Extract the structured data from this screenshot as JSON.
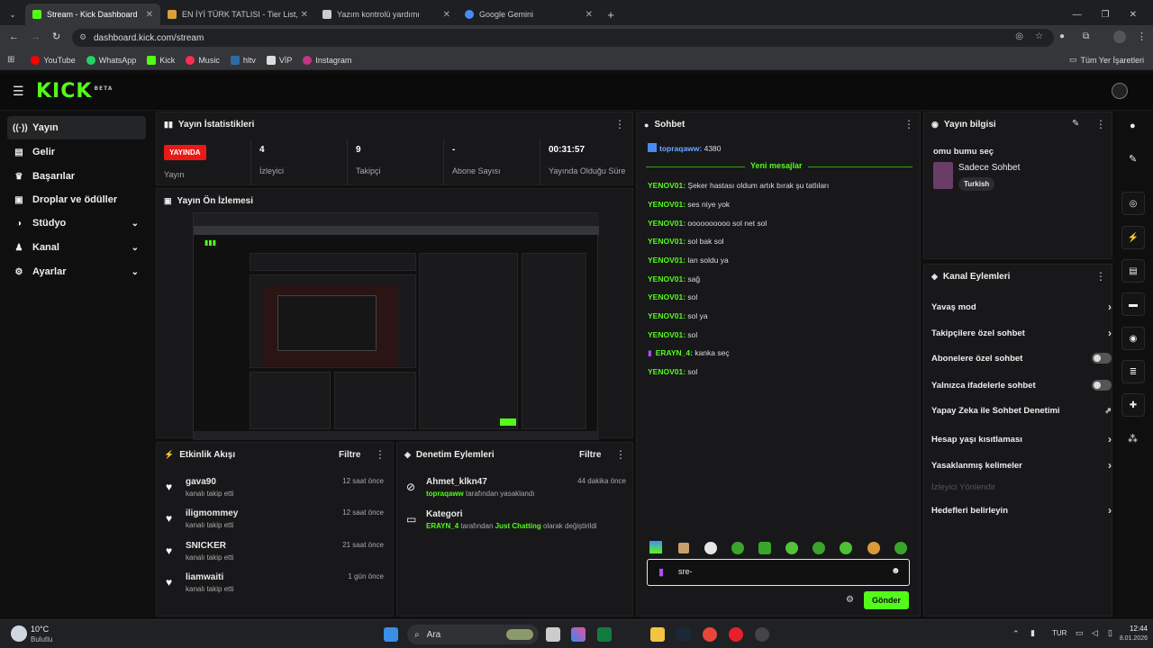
{
  "browser": {
    "tabs": [
      {
        "title": "Stream - Kick Dashboard",
        "color": "#53fc18",
        "active": true
      },
      {
        "title": "EN İYİ TÜRK TATLISI - Tier List,",
        "color": "#d8a13a",
        "active": false
      },
      {
        "title": "Yazım kontrolü yardımı",
        "color": "#cccccc",
        "active": false
      },
      {
        "title": "Google Gemini",
        "color": "#4b8af5",
        "active": false
      }
    ],
    "url": "dashboard.kick.com/stream",
    "bookmarks": [
      "YouTube",
      "WhatsApp",
      "Kick",
      "Music",
      "hltv",
      "VİP",
      "Instagram"
    ],
    "bookmarks_right": "Tüm Yer İşaretleri"
  },
  "kick": {
    "logo": "KICK",
    "logo_tag": "BETA",
    "sidebar": [
      {
        "label": "Yayın",
        "icon": "broadcast-icon",
        "active": true,
        "chevron": false
      },
      {
        "label": "Gelir",
        "icon": "wallet-icon",
        "active": false,
        "chevron": false
      },
      {
        "label": "Başarılar",
        "icon": "trophy-icon",
        "active": false,
        "chevron": false
      },
      {
        "label": "Droplar ve ödüller",
        "icon": "gift-icon",
        "active": false,
        "chevron": false
      },
      {
        "label": "Stüdyo",
        "icon": "studio-icon",
        "active": false,
        "chevron": true
      },
      {
        "label": "Kanal",
        "icon": "channel-icon",
        "active": false,
        "chevron": true
      },
      {
        "label": "Ayarlar",
        "icon": "gear-icon",
        "active": false,
        "chevron": true
      }
    ],
    "stats": {
      "title": "Yayın İstatistikleri",
      "live_badge": "YAYINDA",
      "live_label": "Yayın",
      "viewers_value": "4",
      "viewers_label": "İzleyici",
      "followers_value": "9",
      "followers_label": "Takipçi",
      "subs_value": "-",
      "subs_label": "Abone Sayısı",
      "duration_value": "00:31:57",
      "duration_label": "Yayında Olduğu Süre"
    },
    "preview": {
      "title": "Yayın Ön İzlemesi"
    },
    "activity": {
      "title": "Etkinlik Akışı",
      "filter": "Filtre",
      "items": [
        {
          "name": "gava90",
          "sub": "kanalı takip etti",
          "time": "12 saat önce"
        },
        {
          "name": "iligmommey",
          "sub": "kanalı takip etti",
          "time": "12 saat önce"
        },
        {
          "name": "SNICKER",
          "sub": "kanalı takip etti",
          "time": "21 saat önce"
        },
        {
          "name": "liamwaiti",
          "sub": "kanalı takip etti",
          "time": "1 gün önce"
        }
      ]
    },
    "moderation": {
      "title": "Denetim Eylemleri",
      "filter": "Filtre",
      "items": [
        {
          "name": "Ahmet_klkn47",
          "time": "44 dakika önce",
          "actor": "topraqaww",
          "rest": " tarafından yasaklandı"
        },
        {
          "name": "Kategori",
          "time": "",
          "actor": "ERAYN_4",
          "rest": " tarafından ",
          "highlight": "Just Chatting",
          "rest2": " olarak değiştirildi"
        }
      ]
    },
    "chat": {
      "title": "Sohbet",
      "pinned_user": "topraqaww:",
      "pinned_text": " 4380",
      "new_messages": "Yeni mesajlar",
      "messages": [
        {
          "user": "YENOV01:",
          "text": " Şeker hastası oldum artık bırak şu tatlıları"
        },
        {
          "user": "YENOV01:",
          "text": " ses niye yok"
        },
        {
          "user": "YENOV01:",
          "text": " oooooooooo sol net sol"
        },
        {
          "user": "YENOV01:",
          "text": " sol bak sol"
        },
        {
          "user": "YENOV01:",
          "text": " lan soldu ya"
        },
        {
          "user": "YENOV01:",
          "text": " sağ"
        },
        {
          "user": "YENOV01:",
          "text": " sol"
        },
        {
          "user": "YENOV01:",
          "text": " sol ya"
        },
        {
          "user": "YENOV01:",
          "text": " sol"
        },
        {
          "user": "ERAYN_4:",
          "text": " kanka seç"
        },
        {
          "user": "YENOV01:",
          "text": " sol"
        }
      ],
      "input_value": "sre-",
      "send": "Gönder"
    },
    "stream_info": {
      "title": "Yayın bilgisi",
      "stream_title": "omu bumu seç",
      "category": "Sadece Sohbet",
      "tag": "Turkish"
    },
    "channel_actions": {
      "title": "Kanal Eylemleri",
      "items": [
        {
          "label": "Yavaş mod",
          "type": "arrow"
        },
        {
          "label": "Takipçilere özel sohbet",
          "type": "arrow"
        },
        {
          "label": "Abonelere özel sohbet",
          "type": "toggle"
        },
        {
          "label": "Yalnızca ifadelerle sohbet",
          "type": "toggle"
        },
        {
          "label": "Yapay Zeka ile Sohbet Denetimi",
          "type": "external"
        },
        {
          "label": "Hesap yaşı kısıtlaması",
          "type": "arrow"
        },
        {
          "label": "Yasaklanmış kelimeler",
          "type": "arrow"
        },
        {
          "label": "İzleyici Yönlendir",
          "type": "disabled"
        },
        {
          "label": "Hedefleri belirleyin",
          "type": "arrow"
        }
      ]
    }
  },
  "taskbar": {
    "weather_temp": "10°C",
    "weather_text": "Bulutlu",
    "search": "Ara",
    "lang": "TUR",
    "time": "12:44",
    "date": "8.01.2026"
  }
}
